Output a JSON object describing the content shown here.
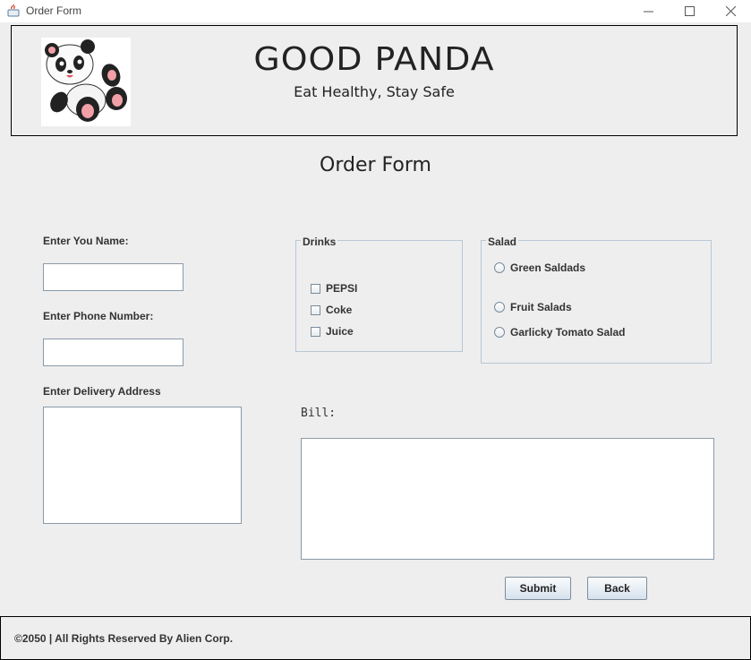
{
  "window": {
    "title": "Order Form"
  },
  "header": {
    "brand": "GOOD PANDA",
    "tagline": "Eat Healthy, Stay Safe"
  },
  "form": {
    "title": "Order Form",
    "name_label": "Enter You Name:",
    "name_value": "",
    "phone_label": "Enter Phone Number:",
    "phone_value": "",
    "address_label": "Enter Delivery Address",
    "address_value": ""
  },
  "drinks": {
    "legend": "Drinks",
    "options": [
      "PEPSI",
      "Coke",
      "Juice"
    ]
  },
  "salad": {
    "legend": "Salad",
    "options": [
      "Green Saldads",
      "Fruit Salads",
      "Garlicky Tomato Salad"
    ]
  },
  "bill": {
    "label": "Bill:",
    "value": ""
  },
  "buttons": {
    "submit": "Submit",
    "back": "Back"
  },
  "footer": {
    "text": "©2050 | All Rights Reserved By Alien Corp."
  }
}
